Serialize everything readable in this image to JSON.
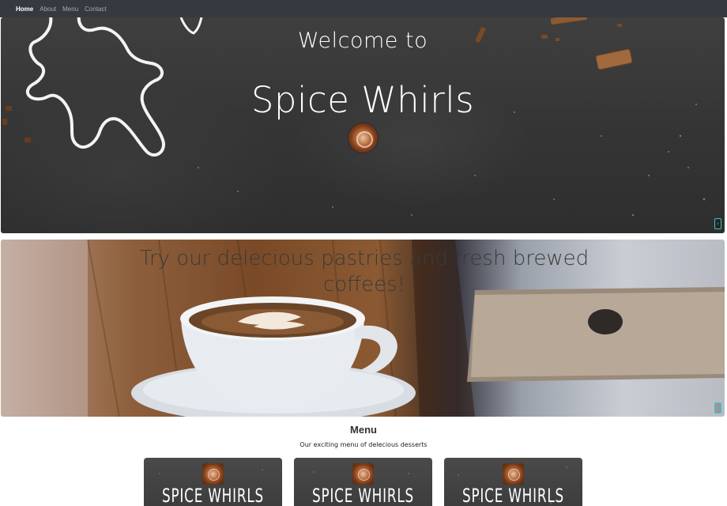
{
  "nav": {
    "items": [
      {
        "label": "Home",
        "active": true
      },
      {
        "label": "About",
        "active": false
      },
      {
        "label": "Menu",
        "active": false
      },
      {
        "label": "Contact",
        "active": false
      }
    ]
  },
  "hero_welcome": {
    "kicker": "Welcome to",
    "title": "Spice Whirls",
    "logo_icon": "cinnamon-roll-logo-icon",
    "next_control": "›"
  },
  "hero_coffee": {
    "text": "Try our delecious pastries and fresh brewed coffees!",
    "next_control": "›"
  },
  "menu": {
    "title": "Menu",
    "subtitle": "Our exciting menu of delecious desserts",
    "cards": [
      {
        "name": "SPICE WHIRLS"
      },
      {
        "name": "SPICE WHIRLS"
      },
      {
        "name": "SPICE WHIRLS"
      }
    ]
  },
  "colors": {
    "navbar": "#343a40",
    "control_accent": "#3ac6c6"
  }
}
